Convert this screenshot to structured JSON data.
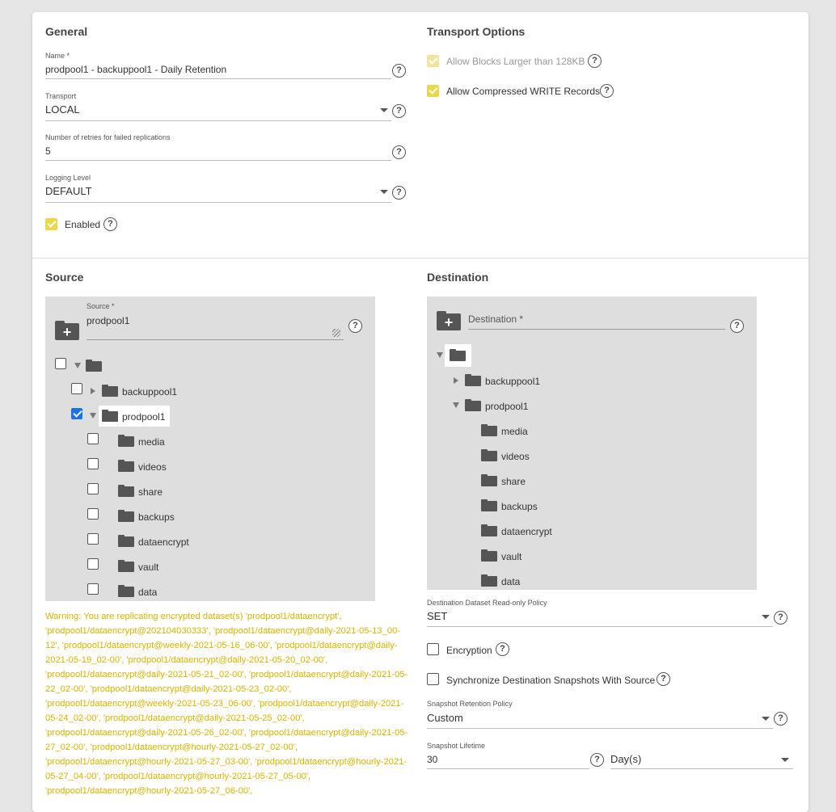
{
  "general": {
    "title": "General",
    "name_label": "Name *",
    "name_value": "prodpool1 - backuppool1 - Daily Retention",
    "transport_label": "Transport",
    "transport_value": "LOCAL",
    "retries_label": "Number of retries for failed replications",
    "retries_value": "5",
    "logging_label": "Logging Level",
    "logging_value": "DEFAULT",
    "enabled_label": "Enabled"
  },
  "transport_options": {
    "title": "Transport Options",
    "allow_large_blocks": "Allow Blocks Larger than 128KB",
    "allow_compressed": "Allow Compressed WRITE Records"
  },
  "source": {
    "title": "Source",
    "field_label": "Source *",
    "field_value": "prodpool1",
    "tree": {
      "top_level": [
        "backuppool1",
        "prodpool1"
      ],
      "children": [
        "media",
        "videos",
        "share",
        "backups",
        "dataencrypt",
        "vault",
        "data"
      ]
    }
  },
  "destination": {
    "title": "Destination",
    "field_placeholder": "Destination *",
    "tree": {
      "top_level": [
        "backuppool1",
        "prodpool1"
      ],
      "children": [
        "media",
        "videos",
        "share",
        "backups",
        "dataencrypt",
        "vault",
        "data"
      ]
    },
    "readonly_label": "Destination Dataset Read-only Policy",
    "readonly_value": "SET",
    "encryption_label": "Encryption",
    "sync_label": "Synchronize Destination Snapshots With Source",
    "retention_label": "Snapshot Retention Policy",
    "retention_value": "Custom",
    "lifetime_label": "Snapshot Lifetime",
    "lifetime_value": "30",
    "lifetime_unit": "Day(s)"
  },
  "warning": "Warning: You are replicating encrypted dataset(s) 'prodpool1/dataencrypt', 'prodpool1/dataencrypt@202104030333', 'prodpool1/dataencrypt@daily-2021-05-13_00-12', 'prodpool1/dataencrypt@weekly-2021-05-16_06-00', 'prodpool1/dataencrypt@daily-2021-05-19_02-00', 'prodpool1/dataencrypt@daily-2021-05-20_02-00', 'prodpool1/dataencrypt@daily-2021-05-21_02-00', 'prodpool1/dataencrypt@daily-2021-05-22_02-00', 'prodpool1/dataencrypt@daily-2021-05-23_02-00', 'prodpool1/dataencrypt@weekly-2021-05-23_06-00', 'prodpool1/dataencrypt@daily-2021-05-24_02-00', 'prodpool1/dataencrypt@daily-2021-05-25_02-00', 'prodpool1/dataencrypt@daily-2021-05-26_02-00', 'prodpool1/dataencrypt@daily-2021-05-27_02-00', 'prodpool1/dataencrypt@hourly-2021-05-27_02-00', 'prodpool1/dataencrypt@hourly-2021-05-27_03-00', 'prodpool1/dataencrypt@hourly-2021-05-27_04-00', 'prodpool1/dataencrypt@hourly-2021-05-27_05-00', 'prodpool1/dataencrypt@hourly-2021-05-27_06-00',",
  "colors": {
    "accent_yellow": "#e8d84a",
    "warning_text": "#d9b400",
    "checkbox_blue": "#1a73e8"
  }
}
